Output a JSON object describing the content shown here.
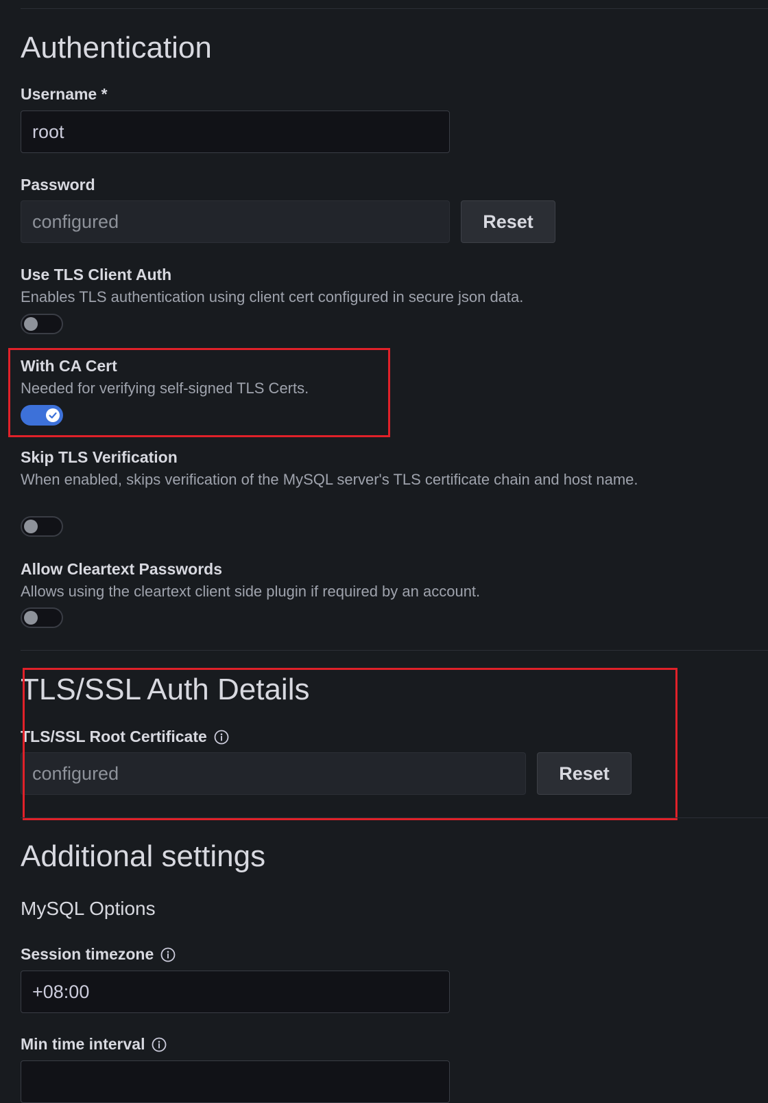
{
  "authentication": {
    "title": "Authentication",
    "username": {
      "label": "Username *",
      "value": "root"
    },
    "password": {
      "label": "Password",
      "value": "configured",
      "reset_label": "Reset"
    },
    "tls_client_auth": {
      "label": "Use TLS Client Auth",
      "description": "Enables TLS authentication using client cert configured in secure json data.",
      "enabled": false
    },
    "ca_cert": {
      "label": "With CA Cert",
      "description": "Needed for verifying self-signed TLS Certs.",
      "enabled": true
    },
    "skip_tls": {
      "label": "Skip TLS Verification",
      "description": "When enabled, skips verification of the MySQL server's TLS certificate chain and host name.",
      "enabled": false
    },
    "cleartext": {
      "label": "Allow Cleartext Passwords",
      "description": "Allows using the cleartext client side plugin if required by an account.",
      "enabled": false
    }
  },
  "tls_details": {
    "title": "TLS/SSL Auth Details",
    "root_cert": {
      "label": "TLS/SSL Root Certificate",
      "value": "configured",
      "reset_label": "Reset"
    }
  },
  "additional": {
    "title": "Additional settings",
    "mysql_options_title": "MySQL Options",
    "session_timezone": {
      "label": "Session timezone",
      "value": "+08:00"
    },
    "min_time_interval": {
      "label": "Min time interval"
    }
  },
  "colors": {
    "background": "#181b1f",
    "accent": "#3d71d9",
    "highlight": "#e02129"
  }
}
